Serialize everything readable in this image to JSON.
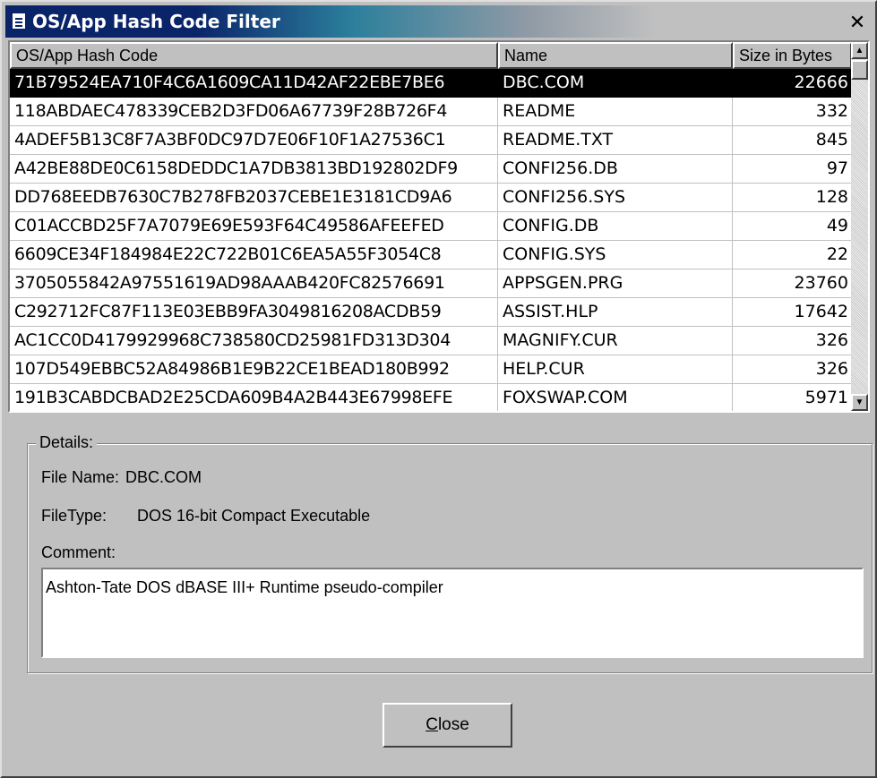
{
  "window": {
    "title": "OS/App Hash Code Filter",
    "close_glyph": "✕"
  },
  "table": {
    "columns": [
      "OS/App Hash Code",
      "Name",
      "Size in Bytes"
    ],
    "rows": [
      {
        "hash": "71B79524EA710F4C6A1609CA11D42AF22EBE7BE6",
        "name": "DBC.COM",
        "size": "22666",
        "selected": true
      },
      {
        "hash": "118ABDAEC478339CEB2D3FD06A67739F28B726F4",
        "name": "README",
        "size": "332"
      },
      {
        "hash": "4ADEF5B13C8F7A3BF0DC97D7E06F10F1A27536C1",
        "name": "README.TXT",
        "size": "845"
      },
      {
        "hash": "A42BE88DE0C6158DEDDC1A7DB3813BD192802DF9",
        "name": "CONFI256.DB",
        "size": "97"
      },
      {
        "hash": "DD768EEDB7630C7B278FB2037CEBE1E3181CD9A6",
        "name": "CONFI256.SYS",
        "size": "128"
      },
      {
        "hash": "C01ACCBD25F7A7079E69E593F64C49586AFEEFED",
        "name": "CONFIG.DB",
        "size": "49"
      },
      {
        "hash": "6609CE34F184984E22C722B01C6EA5A55F3054C8",
        "name": "CONFIG.SYS",
        "size": "22"
      },
      {
        "hash": "3705055842A97551619AD98AAAB420FC82576691",
        "name": "APPSGEN.PRG",
        "size": "23760"
      },
      {
        "hash": "C292712FC87F113E03EBB9FA3049816208ACDB59",
        "name": "ASSIST.HLP",
        "size": "17642"
      },
      {
        "hash": "AC1CC0D4179929968C738580CD25981FD313D304",
        "name": "MAGNIFY.CUR",
        "size": "326"
      },
      {
        "hash": "107D549EBBC52A84986B1E9B22CE1BEAD180B992",
        "name": "HELP.CUR",
        "size": "326"
      },
      {
        "hash": "191B3CABDCBAD2E25CDA609B4A2B443E67998EFE",
        "name": "FOXSWAP.COM",
        "size": "5971"
      }
    ]
  },
  "details": {
    "legend": "Details:",
    "file_name_label": "File Name:",
    "file_name": "DBC.COM",
    "file_type_label": "FileType:",
    "file_type": "DOS 16-bit Compact Executable",
    "comment_label": "Comment:",
    "comment": "Ashton-Tate DOS dBASE III+ Runtime pseudo-compiler"
  },
  "buttons": {
    "close_first": "C",
    "close_rest": "lose"
  },
  "colors": {
    "title_active": "#0a246a",
    "selection": "#000000",
    "face": "#c0c0c0"
  }
}
